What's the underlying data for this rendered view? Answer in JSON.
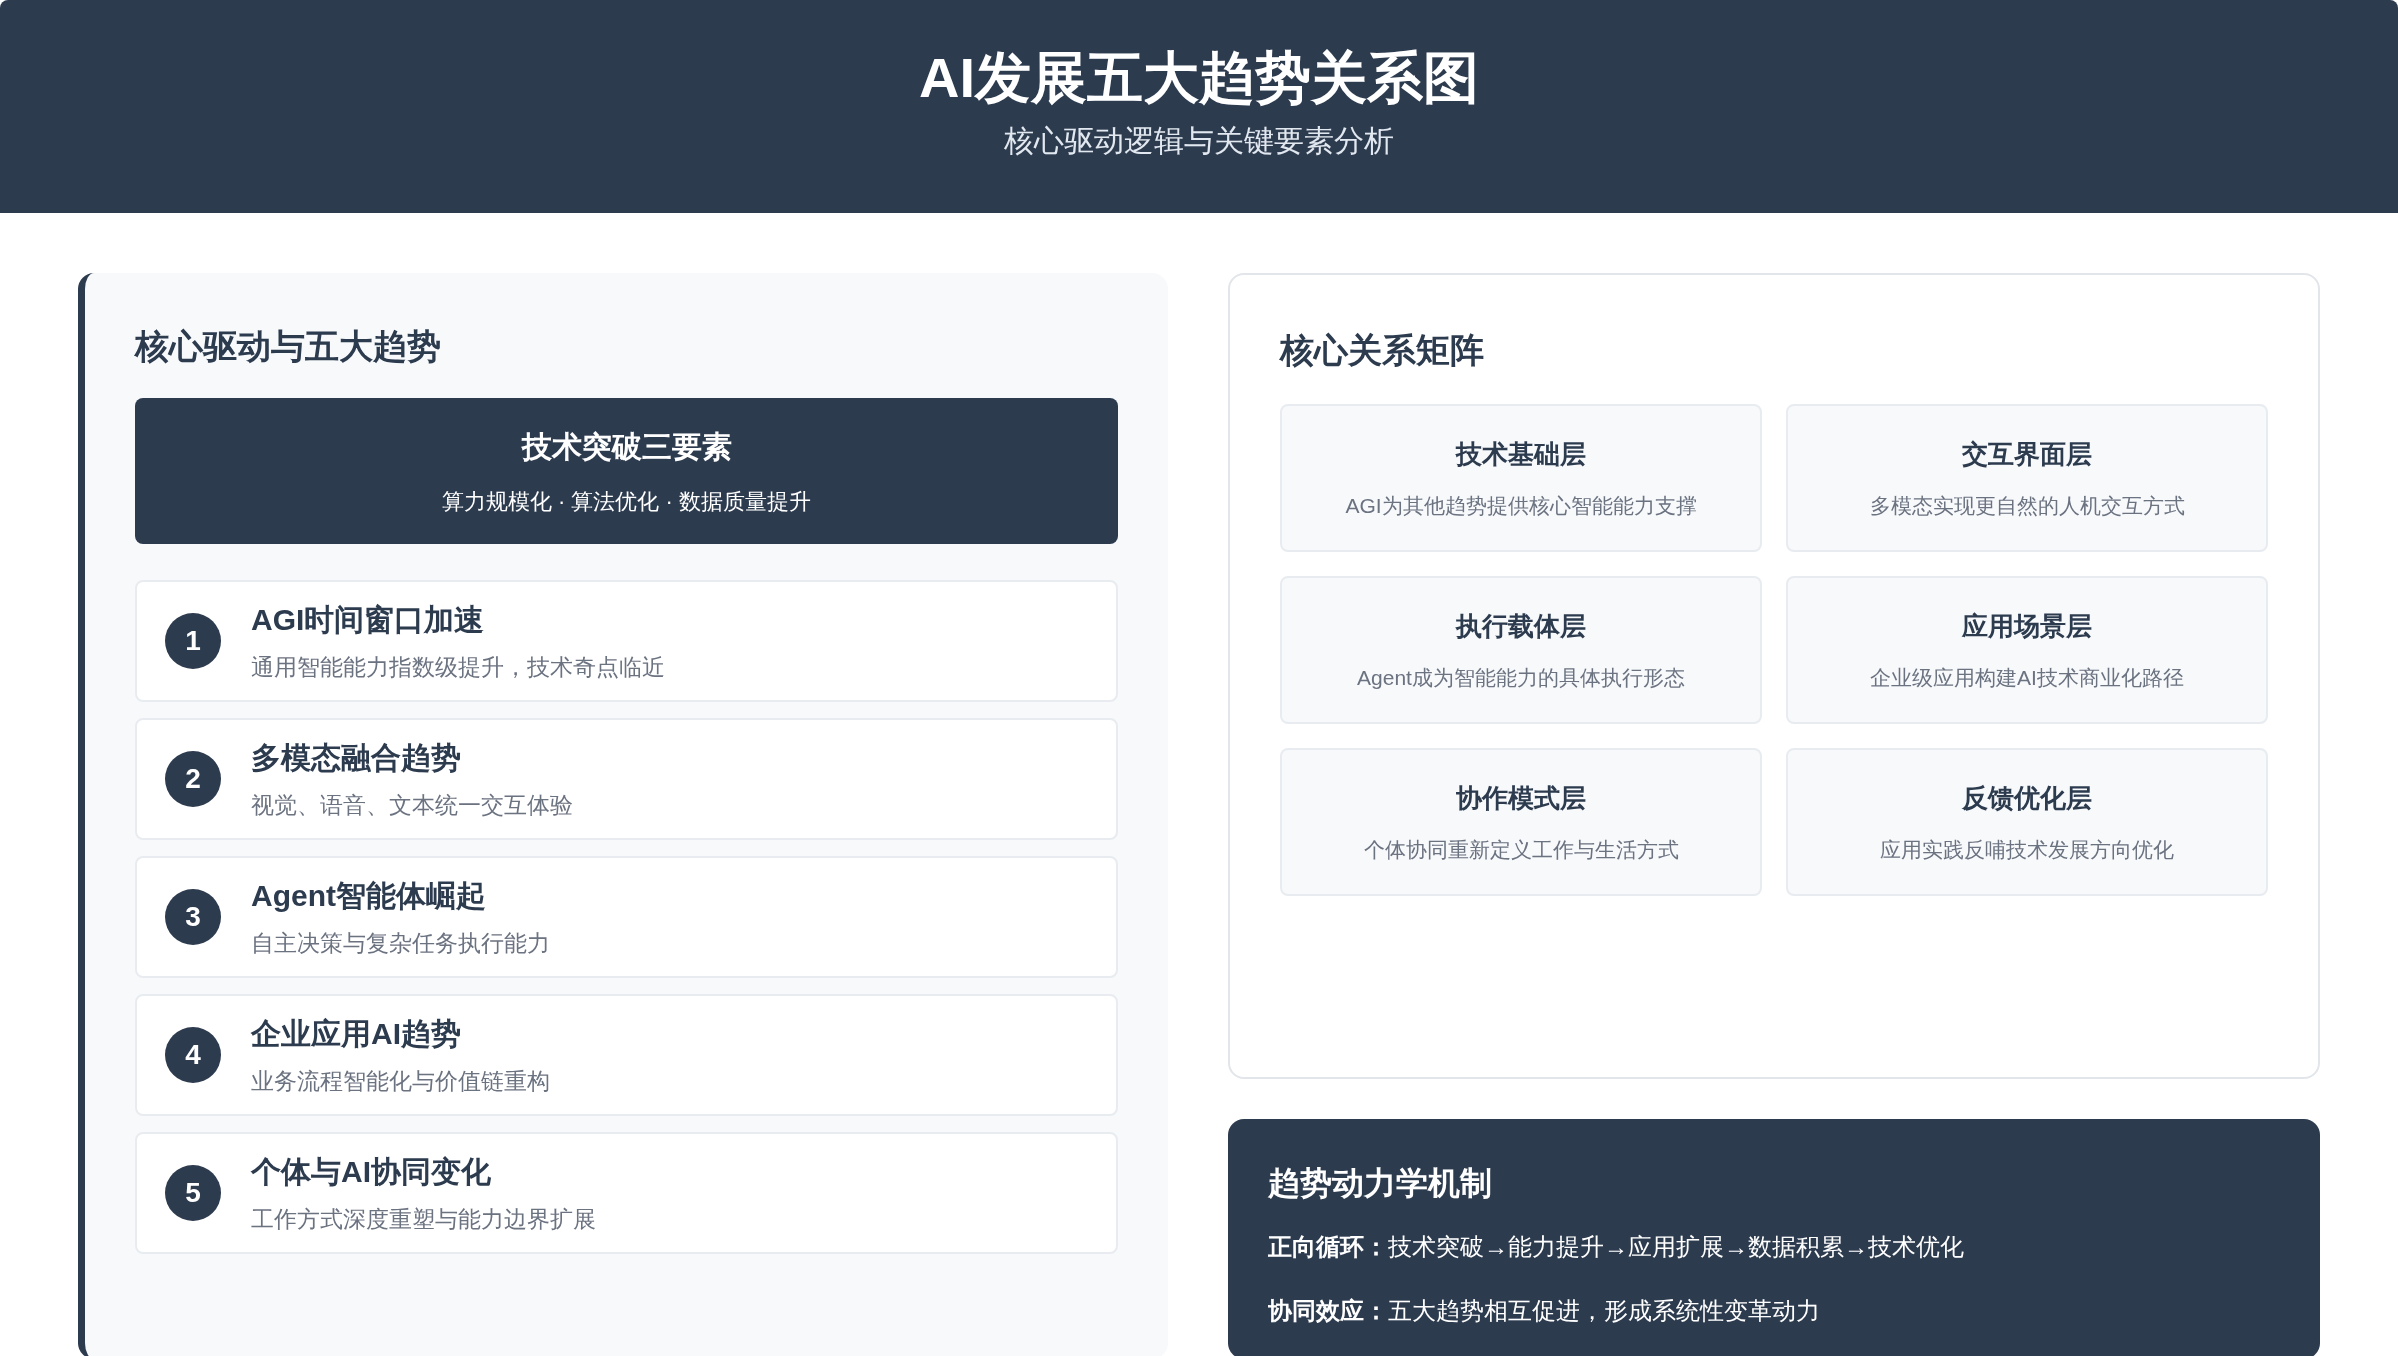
{
  "header": {
    "title": "AI发展五大趋势关系图",
    "subtitle": "核心驱动逻辑与关键要素分析"
  },
  "left_panel": {
    "title": "核心驱动与五大趋势",
    "driver": {
      "title": "技术突破三要素",
      "subtitle": "算力规模化 · 算法优化 · 数据质量提升"
    },
    "trends": [
      {
        "number": "1",
        "title": "AGI时间窗口加速",
        "description": "通用智能能力指数级提升，技术奇点临近"
      },
      {
        "number": "2",
        "title": "多模态融合趋势",
        "description": "视觉、语音、文本统一交互体验"
      },
      {
        "number": "3",
        "title": "Agent智能体崛起",
        "description": "自主决策与复杂任务执行能力"
      },
      {
        "number": "4",
        "title": "企业应用AI趋势",
        "description": "业务流程智能化与价值链重构"
      },
      {
        "number": "5",
        "title": "个体与AI协同变化",
        "description": "工作方式深度重塑与能力边界扩展"
      }
    ]
  },
  "matrix": {
    "title": "核心关系矩阵",
    "cells": [
      {
        "title": "技术基础层",
        "description": "AGI为其他趋势提供核心智能能力支撑"
      },
      {
        "title": "交互界面层",
        "description": "多模态实现更自然的人机交互方式"
      },
      {
        "title": "执行载体层",
        "description": "Agent成为智能能力的具体执行形态"
      },
      {
        "title": "应用场景层",
        "description": "企业级应用构建AI技术商业化路径"
      },
      {
        "title": "协作模式层",
        "description": "个体协同重新定义工作与生活方式"
      },
      {
        "title": "反馈优化层",
        "description": "应用实践反哺技术发展方向优化"
      }
    ]
  },
  "dynamics": {
    "title": "趋势动力学机制",
    "lines": [
      "**正向循环：**技术突破→能力提升→应用扩展→数据积累→技术优化",
      "**协同效应：**五大趋势相互促进，形成系统性变革动力"
    ]
  }
}
